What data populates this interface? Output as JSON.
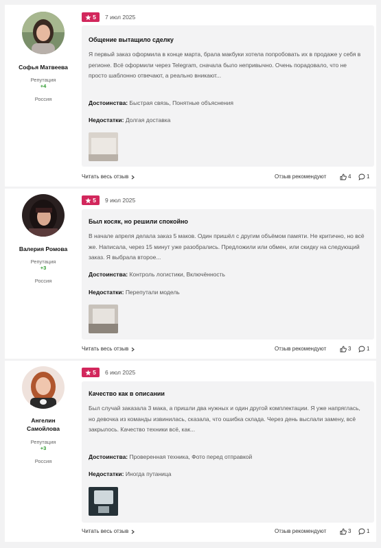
{
  "reviews": [
    {
      "author": "Софья Матвеева",
      "reputation_label": "Репутация",
      "reputation_value": "+4",
      "country": "Россия",
      "rating": "5",
      "date": "7 июл 2025",
      "title": "Общение вытащило сделку",
      "text": "Я первый заказ оформила в конце марта, брала макбуки хотела попробовать их в продаже у себя в регионе. Всё оформили через Telegram, сначала было непривычно. Очень порадовало, что не просто шаблонно отвечают, а реально вникают...",
      "pros_label": "Достоинства:",
      "pros": "Быстрая связь, Понятные объяснения",
      "cons_label": "Недостатки:",
      "cons": "Долгая доставка",
      "read_more": "Читать весь отзыв",
      "recommend": "Отзыв рекомендуют",
      "likes": "4",
      "comments": "1"
    },
    {
      "author": "Валерия Ромова",
      "reputation_label": "Репутация",
      "reputation_value": "+3",
      "country": "Россия",
      "rating": "5",
      "date": "9 июл 2025",
      "title": "Был косяк, но решили спокойно",
      "text": "В начале апреля делала заказ 5 маков. Один пришёл с другим объёмом памяти. Не критично, но всё же. Написала, через 15 минут уже разобрались. Предложили или обмен, или скидку на следующий заказ. Я выбрала второе...",
      "pros_label": "Достоинства:",
      "pros": "Контроль логистики, Включённость",
      "cons_label": "Недостатки:",
      "cons": "Перепутали модель",
      "read_more": "Читать весь отзыв",
      "recommend": "Отзыв рекомендуют",
      "likes": "3",
      "comments": "1"
    },
    {
      "author": "Ангелин Самойлова",
      "author_line1": "Ангелин",
      "author_line2": "Самойлова",
      "reputation_label": "Репутация",
      "reputation_value": "+3",
      "country": "Россия",
      "rating": "5",
      "date": "6 июл 2025",
      "title": "Качество как в описании",
      "text": "Был случай заказала 3 мака, а пришли два нужных и один другой комплектации. Я уже напряглась, но девочка из команды извинилась, сказала, что ошибка склада. Через день выслали замену, всё закрылось. Качество техники всё, как...",
      "pros_label": "Достоинства:",
      "pros": "Проверенная техника, Фото перед отправкой",
      "cons_label": "Недостатки:",
      "cons": "Иногда путаница",
      "read_more": "Читать весь отзыв",
      "recommend": "Отзыв рекомендуют",
      "likes": "3",
      "comments": "1"
    }
  ],
  "colors": {
    "rating_badge": "#d2275c",
    "reputation": "#2e9a2e",
    "box_bg": "#f3f3f4"
  },
  "icons": {
    "rating": "star-icon",
    "read_more": "chevron-right-icon",
    "likes": "thumbs-up-icon",
    "comments": "comment-icon"
  }
}
